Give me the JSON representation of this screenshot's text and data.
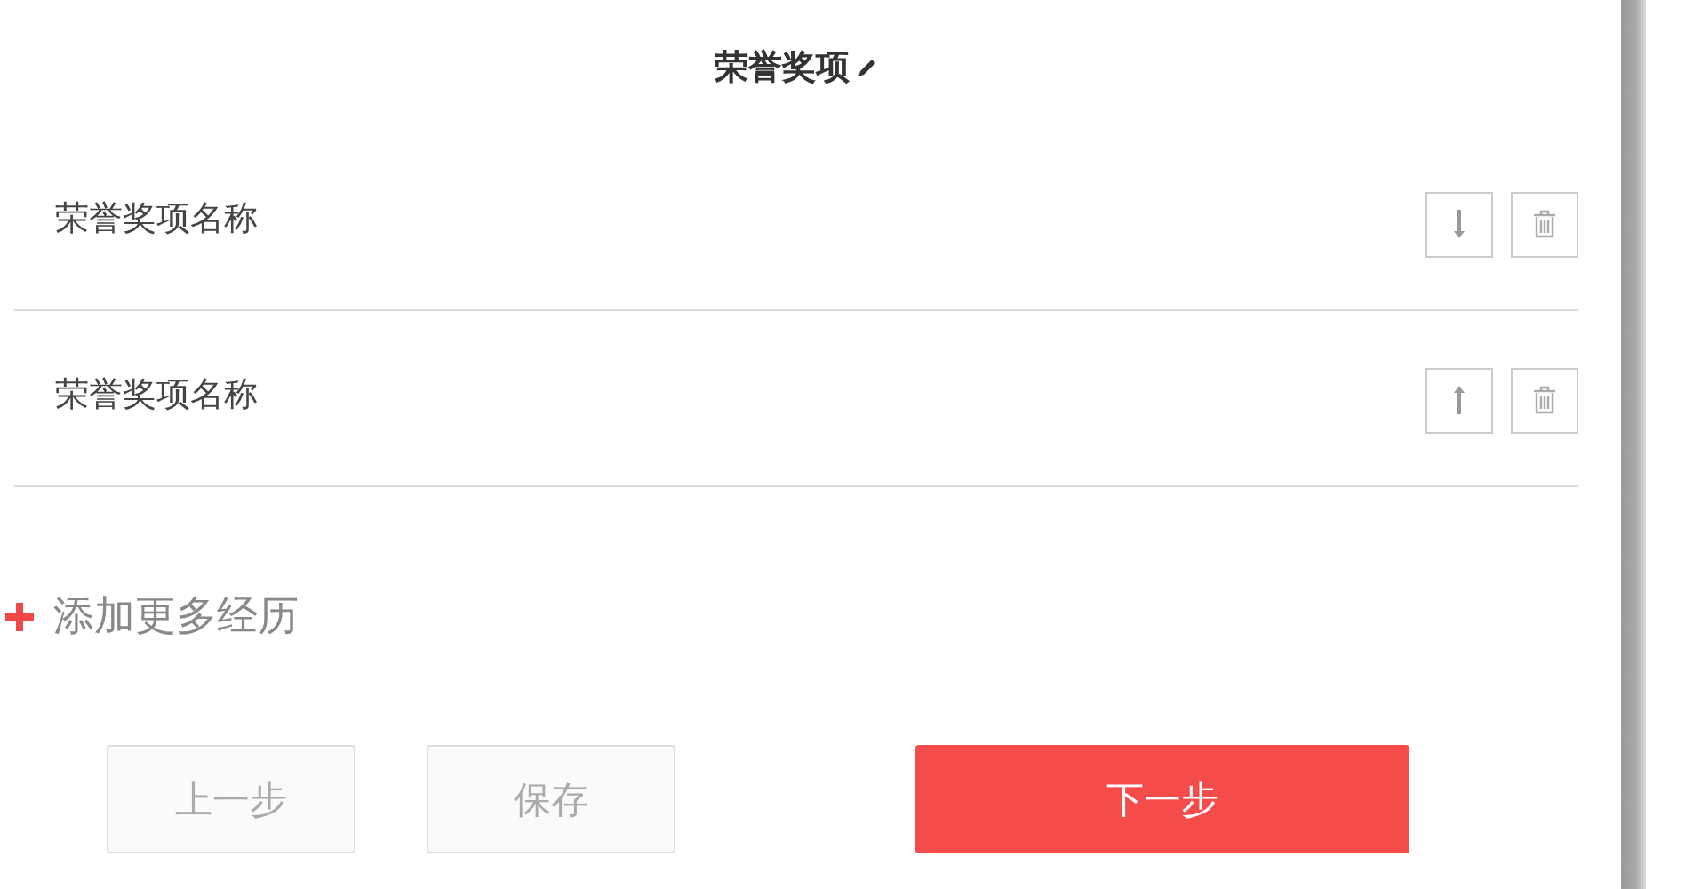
{
  "section": {
    "title": "荣誉奖项"
  },
  "items": [
    {
      "name": "荣誉奖项名称",
      "kind": "move_down"
    },
    {
      "name": "荣誉奖项名称",
      "kind": "move_up"
    }
  ],
  "add_link": "添加更多经历",
  "buttons": [
    {
      "label": "上一步",
      "kind": "secondary"
    },
    {
      "label": "保存",
      "kind": "secondary"
    },
    {
      "label": "下一步",
      "kind": "primary"
    }
  ]
}
